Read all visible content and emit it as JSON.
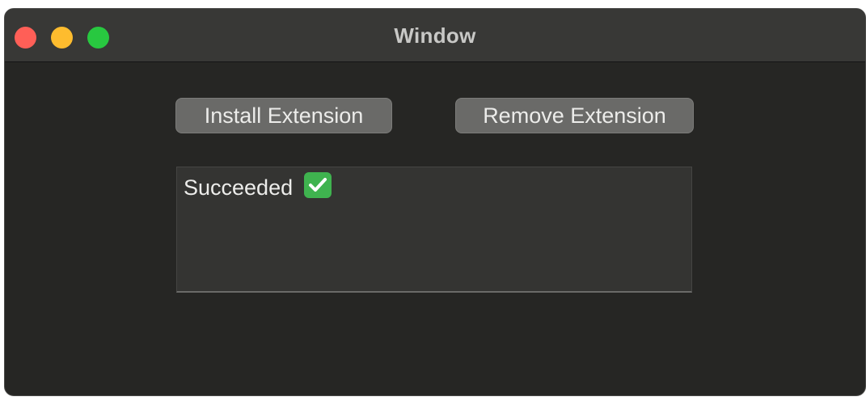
{
  "window": {
    "title": "Window",
    "traffic_lights": {
      "close_color": "#ff5f57",
      "minimize_color": "#febc2e",
      "zoom_color": "#28c840"
    }
  },
  "actions": {
    "install_label": "Install Extension",
    "remove_label": "Remove Extension"
  },
  "output": {
    "text": "Succeeded",
    "status_icon": "white-check-mark-icon",
    "status_color": "#3fb34f"
  }
}
